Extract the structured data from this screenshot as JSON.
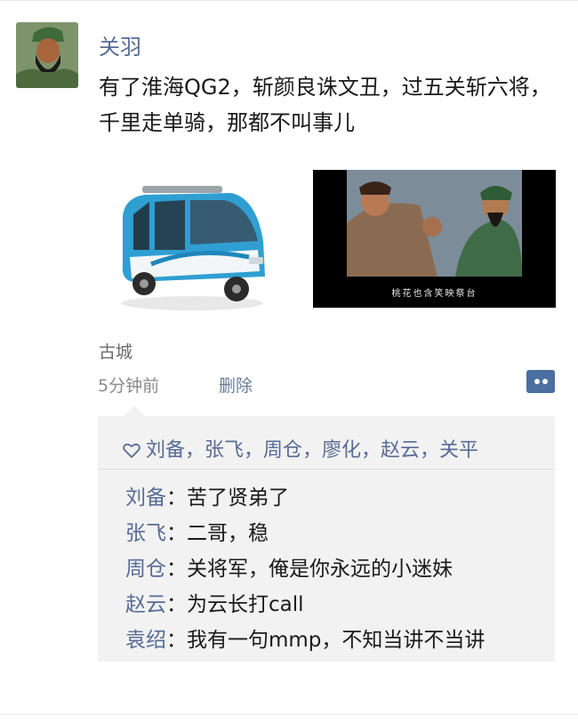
{
  "post": {
    "username": "关羽",
    "text": "有了淮海QG2，斩颜良诛文丑，过五关斩六将，千里走单骑，那都不叫事儿",
    "location": "古城",
    "time": "5分钟前",
    "delete_label": "删除",
    "image2_caption": "桃花也含笑映祭台"
  },
  "likes": {
    "names": "刘备，张飞，周仓，廖化，赵云，关平"
  },
  "comments": [
    {
      "author": "刘备",
      "sep": "：",
      "text": "苦了贤弟了"
    },
    {
      "author": "张飞",
      "sep": "：",
      "text": "二哥，稳"
    },
    {
      "author": "周仓",
      "sep": "：",
      "text": "关将军，俺是你永远的小迷妹"
    },
    {
      "author": "赵云",
      "sep": "：",
      "text": "为云长打call"
    },
    {
      "author": "袁绍",
      "sep": "：",
      "text": "我有一句mmp，不知当讲不当讲"
    }
  ],
  "icons": {
    "more": "comment-more-icon",
    "like": "heart-outline-icon"
  },
  "colors": {
    "link": "#576b95",
    "comment_bg": "#f2f2f2",
    "more_button": "#4b6fa0"
  }
}
